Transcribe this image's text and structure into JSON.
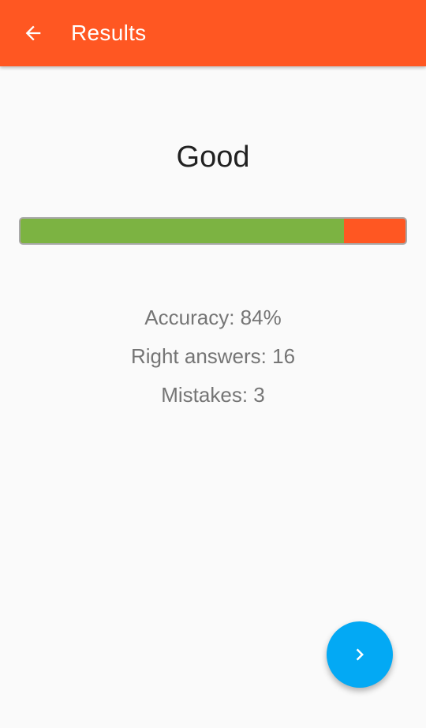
{
  "app_bar": {
    "title": "Results",
    "back_icon": "arrow-left-icon",
    "color": "#ff5722"
  },
  "result": {
    "grade": "Good",
    "accuracy_fraction": 0.84,
    "progress_right_color": "#7cb342",
    "progress_wrong_color": "#ff5722"
  },
  "stats": {
    "accuracy": "Accuracy: 84%",
    "right_answers": "Right answers: 16",
    "mistakes": "Mistakes: 3"
  },
  "fab": {
    "icon": "chevron-right-icon",
    "color": "#03a9f4"
  }
}
